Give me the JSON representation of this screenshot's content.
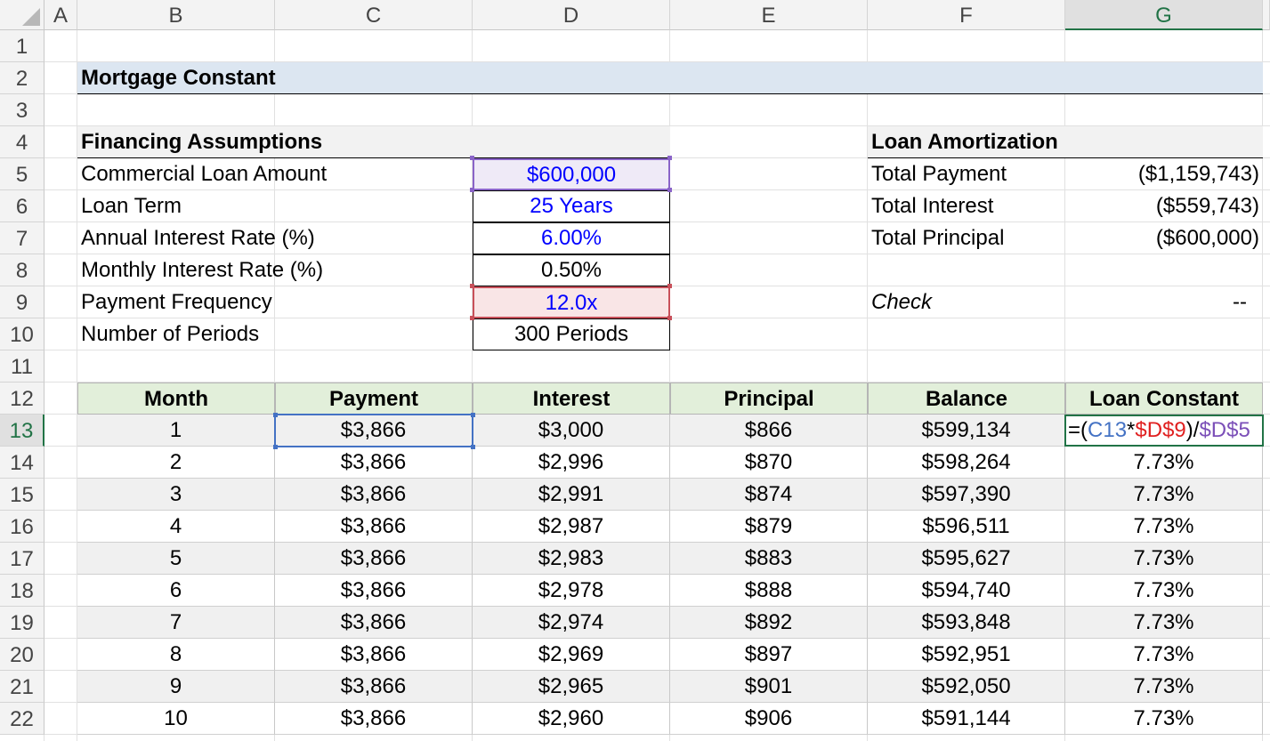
{
  "columns": [
    "A",
    "B",
    "C",
    "D",
    "E",
    "F",
    "G"
  ],
  "selected_column": "G",
  "rows": [
    "1",
    "2",
    "3",
    "4",
    "5",
    "6",
    "7",
    "8",
    "9",
    "10",
    "11",
    "12",
    "13",
    "14",
    "15",
    "16",
    "17",
    "18",
    "19",
    "20",
    "21",
    "22"
  ],
  "selected_row": "13",
  "title": "Mortgage Constant",
  "financing": {
    "header": "Financing Assumptions",
    "items": [
      {
        "label": "Commercial Loan Amount",
        "value": "$600,000"
      },
      {
        "label": "Loan Term",
        "value": "25 Years"
      },
      {
        "label": "Annual Interest Rate (%)",
        "value": "6.00%"
      },
      {
        "label": "Monthly Interest Rate (%)",
        "value": "0.50%"
      },
      {
        "label": "Payment Frequency",
        "value": "12.0x"
      },
      {
        "label": "Number of Periods",
        "value": "300 Periods"
      }
    ]
  },
  "amortization": {
    "header": "Loan Amortization",
    "items": [
      {
        "label": "Total Payment",
        "value": "($1,159,743)"
      },
      {
        "label": "Total Interest",
        "value": "($559,743)"
      },
      {
        "label": "Total Principal",
        "value": "($600,000)"
      }
    ],
    "check_label": "Check",
    "check_value": "--"
  },
  "table": {
    "headers": [
      "Month",
      "Payment",
      "Interest",
      "Principal",
      "Balance",
      "Loan Constant"
    ],
    "rows": [
      [
        "1",
        "$3,866",
        "$3,000",
        "$866",
        "$599,134",
        ""
      ],
      [
        "2",
        "$3,866",
        "$2,996",
        "$870",
        "$598,264",
        "7.73%"
      ],
      [
        "3",
        "$3,866",
        "$2,991",
        "$874",
        "$597,390",
        "7.73%"
      ],
      [
        "4",
        "$3,866",
        "$2,987",
        "$879",
        "$596,511",
        "7.73%"
      ],
      [
        "5",
        "$3,866",
        "$2,983",
        "$883",
        "$595,627",
        "7.73%"
      ],
      [
        "6",
        "$3,866",
        "$2,978",
        "$888",
        "$594,740",
        "7.73%"
      ],
      [
        "7",
        "$3,866",
        "$2,974",
        "$892",
        "$593,848",
        "7.73%"
      ],
      [
        "8",
        "$3,866",
        "$2,969",
        "$897",
        "$592,951",
        "7.73%"
      ],
      [
        "9",
        "$3,866",
        "$2,965",
        "$901",
        "$592,050",
        "7.73%"
      ],
      [
        "10",
        "$3,866",
        "$2,960",
        "$906",
        "$591,144",
        "7.73%"
      ]
    ]
  },
  "formula": {
    "part1": "=(",
    "ref1": "C13",
    "part2": "*",
    "ref2": "$D$9",
    "part3": ")/",
    "ref3": "$D$5"
  }
}
